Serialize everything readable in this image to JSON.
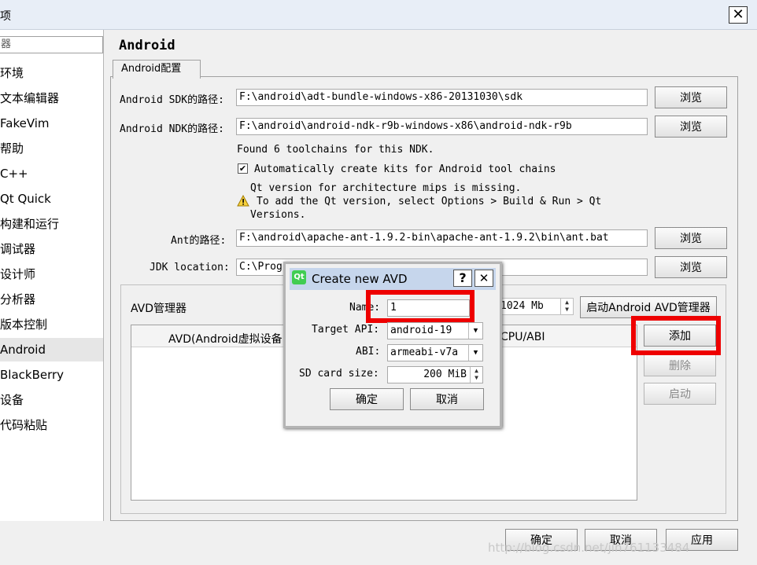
{
  "window": {
    "title": "项",
    "close_glyph": "✕"
  },
  "sidebar": {
    "filter_text": "器",
    "items": [
      {
        "label": "环境"
      },
      {
        "label": "文本编辑器"
      },
      {
        "label": "FakeVim"
      },
      {
        "label": "帮助"
      },
      {
        "label": "C++"
      },
      {
        "label": "Qt Quick"
      },
      {
        "label": "构建和运行"
      },
      {
        "label": "调试器"
      },
      {
        "label": "设计师"
      },
      {
        "label": "分析器"
      },
      {
        "label": "版本控制"
      },
      {
        "label": "Android"
      },
      {
        "label": "BlackBerry"
      },
      {
        "label": "设备"
      },
      {
        "label": "代码粘贴"
      }
    ],
    "selected": "Android"
  },
  "main": {
    "title": "Android",
    "tab": "Android配置",
    "sdk_label": "Android SDK的路径:",
    "sdk_value": "F:\\android\\adt-bundle-windows-x86-20131030\\sdk",
    "ndk_label": "Android NDK的路径:",
    "ndk_value": "F:\\android\\android-ndk-r9b-windows-x86\\android-ndk-r9b",
    "toolchains_text": "Found 6 toolchains for this NDK.",
    "auto_kits_label": "Automatically create kits for Android tool chains",
    "warning_line1": "Qt version for architecture mips is missing.",
    "warning_line2": "To add the Qt version, select Options > Build & Run > Qt",
    "warning_line3": "Versions.",
    "ant_label": "Ant的路径:",
    "ant_value": "F:\\android\\apache-ant-1.9.2-bin\\apache-ant-1.9.2\\bin\\ant.bat",
    "jdk_label": "JDK location:",
    "jdk_value": "C:\\Prog",
    "browse": "浏览"
  },
  "avd": {
    "group_label": "AVD管理器",
    "memory_value": "1024 Mb",
    "start_manager": "启动Android AVD管理器",
    "col_name": "AVD(Android虚拟设备",
    "col_cpu": "CPU/ABI",
    "add": "添加",
    "remove": "删除",
    "start": "启动"
  },
  "dialog": {
    "title": "Create new AVD",
    "help_glyph": "?",
    "close_glyph": "✕",
    "name_label": "Name:",
    "name_value": "1",
    "api_label": "Target API:",
    "api_value": "android-19",
    "abi_label": "ABI:",
    "abi_value": "armeabi-v7a",
    "sd_label": "SD card size:",
    "sd_value": "200 MiB",
    "ok": "确定",
    "cancel": "取消"
  },
  "footer": {
    "ok": "确定",
    "cancel": "取消",
    "apply": "应用"
  },
  "watermark": "http://blog.csdn.net/jin761133484"
}
